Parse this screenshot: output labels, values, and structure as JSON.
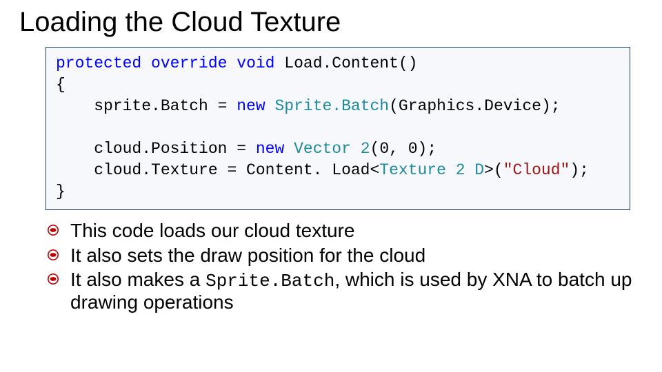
{
  "title": "Loading the Cloud Texture",
  "code": {
    "l1_a": "protected",
    "l1_b": " override",
    "l1_c": " void",
    "l1_d": " Load.Content()",
    "l2": "{",
    "l3_a": "    sprite.Batch = ",
    "l3_b": "new",
    "l3_c": " ",
    "l3_d": "Sprite.Batch",
    "l3_e": "(Graphics.Device);",
    "l4": "",
    "l5_a": "    cloud.Position = ",
    "l5_b": "new",
    "l5_c": " ",
    "l5_d": "Vector 2",
    "l5_e": "(0, 0);",
    "l6_a": "    cloud.Texture = Content. Load<",
    "l6_b": "Texture 2 D",
    "l6_c": ">(",
    "l6_d": "\"Cloud\"",
    "l6_e": ");",
    "l7": "}"
  },
  "bullets": {
    "b1": "This code loads our cloud texture",
    "b2": "It also sets the draw position for the cloud",
    "b3_a": "It also makes a ",
    "b3_code": "Sprite.Batch",
    "b3_b": ", which is used by XNA to batch up drawing operations"
  }
}
